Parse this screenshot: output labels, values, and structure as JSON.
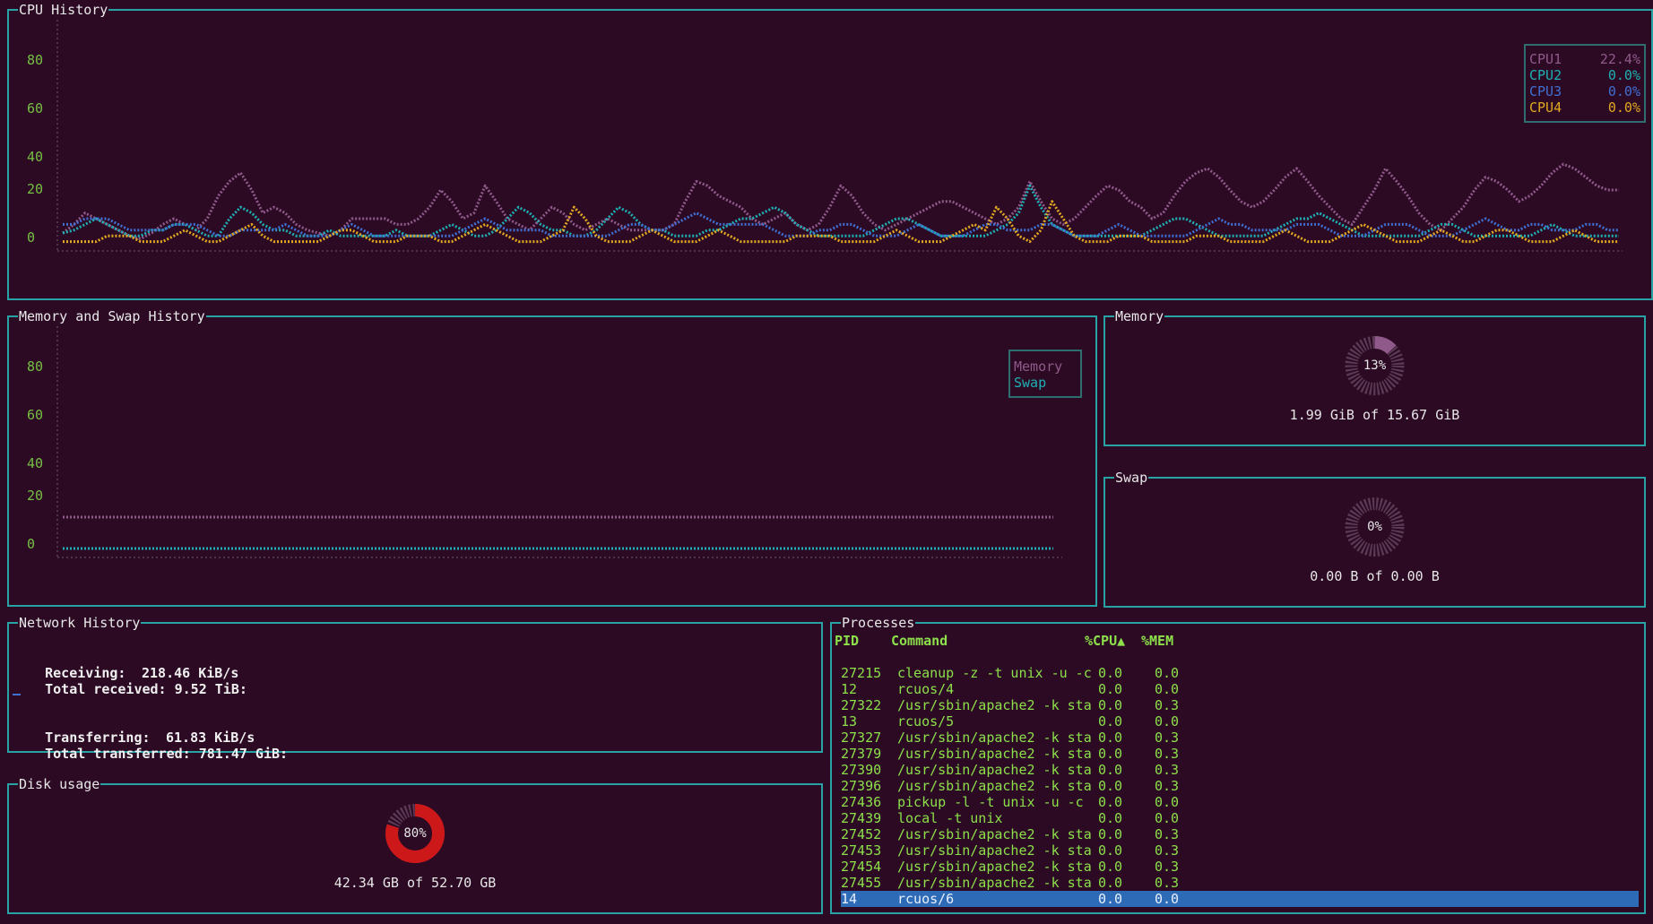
{
  "colors": {
    "border": "#27a3a6",
    "cpu1": "#8f5a8a",
    "cpu2": "#1eb0b4",
    "cpu3": "#3f6fd1",
    "cpu4": "#e2a820",
    "memory": "#8f5a8a",
    "swap": "#1eb0b4",
    "tick": "#76c043",
    "disk": "#cc1818",
    "gauge_track": "#5a3a55",
    "selected_row": "#2e6bb6",
    "proc_text": "#8ce04a"
  },
  "cpu_history": {
    "title": "CPU History",
    "y_ticks": [
      "80",
      "60",
      "40",
      "20",
      "0"
    ],
    "legend": [
      {
        "label": "CPU1",
        "value": "22.4%"
      },
      {
        "label": "CPU2",
        "value": "0.0%"
      },
      {
        "label": "CPU3",
        "value": "0.0%"
      },
      {
        "label": "CPU4",
        "value": "0.0%"
      }
    ],
    "series": {
      "cpu1": [
        5,
        8,
        12,
        10,
        8,
        6,
        4,
        3,
        5,
        8,
        10,
        8,
        6,
        10,
        18,
        24,
        28,
        20,
        12,
        14,
        12,
        8,
        6,
        5,
        4,
        6,
        10,
        10,
        10,
        10,
        8,
        8,
        10,
        14,
        20,
        16,
        10,
        12,
        22,
        16,
        10,
        8,
        6,
        10,
        14,
        12,
        8,
        6,
        8,
        10,
        8,
        6,
        6,
        6,
        6,
        8,
        16,
        24,
        22,
        18,
        16,
        14,
        10,
        8,
        10,
        12,
        8,
        6,
        8,
        14,
        22,
        18,
        12,
        8,
        6,
        8,
        10,
        12,
        14,
        16,
        16,
        14,
        12,
        10,
        8,
        10,
        14,
        24,
        16,
        10,
        8,
        10,
        14,
        18,
        22,
        20,
        16,
        14,
        10,
        12,
        18,
        24,
        28,
        30,
        26,
        20,
        16,
        14,
        16,
        20,
        26,
        30,
        24,
        18,
        14,
        10,
        8,
        14,
        20,
        30,
        24,
        18,
        12,
        8,
        6,
        10,
        14,
        20,
        26,
        24,
        20,
        16,
        18,
        22,
        28,
        32,
        30,
        26,
        22,
        20,
        20
      ],
      "cpu2": [
        5,
        6,
        8,
        10,
        8,
        6,
        4,
        4,
        6,
        6,
        8,
        8,
        6,
        4,
        4,
        10,
        14,
        12,
        8,
        6,
        6,
        4,
        4,
        4,
        6,
        4,
        4,
        4,
        4,
        4,
        6,
        4,
        4,
        4,
        6,
        8,
        6,
        4,
        4,
        6,
        10,
        14,
        12,
        8,
        6,
        6,
        4,
        4,
        6,
        10,
        14,
        12,
        8,
        6,
        6,
        4,
        4,
        4,
        6,
        6,
        8,
        10,
        10,
        12,
        14,
        12,
        8,
        6,
        4,
        4,
        4,
        4,
        4,
        6,
        8,
        10,
        10,
        8,
        6,
        4,
        4,
        4,
        4,
        4,
        6,
        8,
        12,
        22,
        14,
        8,
        6,
        4,
        4,
        4,
        4,
        4,
        4,
        4,
        6,
        8,
        10,
        10,
        8,
        6,
        4,
        4,
        4,
        4,
        4,
        6,
        8,
        10,
        10,
        12,
        10,
        8,
        6,
        4,
        4,
        4,
        4,
        4,
        4,
        6,
        8,
        8,
        6,
        4,
        4,
        4,
        4,
        4,
        4,
        6,
        8,
        6,
        4,
        4,
        4,
        4,
        4
      ],
      "cpu3": [
        8,
        8,
        10,
        10,
        10,
        8,
        6,
        6,
        6,
        6,
        8,
        8,
        8,
        6,
        4,
        4,
        6,
        6,
        6,
        6,
        8,
        6,
        4,
        4,
        4,
        6,
        8,
        6,
        4,
        4,
        4,
        4,
        4,
        4,
        4,
        4,
        6,
        8,
        10,
        8,
        6,
        6,
        6,
        6,
        4,
        4,
        4,
        4,
        4,
        4,
        6,
        8,
        8,
        6,
        6,
        8,
        10,
        12,
        10,
        8,
        8,
        8,
        8,
        8,
        6,
        4,
        4,
        4,
        6,
        6,
        8,
        8,
        6,
        4,
        4,
        4,
        6,
        8,
        6,
        4,
        4,
        4,
        6,
        8,
        8,
        6,
        6,
        6,
        8,
        8,
        6,
        4,
        4,
        4,
        6,
        8,
        6,
        4,
        4,
        4,
        4,
        4,
        6,
        8,
        10,
        8,
        8,
        6,
        6,
        6,
        6,
        8,
        8,
        8,
        6,
        4,
        4,
        4,
        6,
        8,
        8,
        8,
        6,
        4,
        4,
        4,
        6,
        8,
        10,
        8,
        6,
        6,
        8,
        8,
        6,
        6,
        6,
        8,
        8,
        6,
        6
      ],
      "cpu4": [
        2,
        2,
        2,
        2,
        4,
        4,
        4,
        2,
        2,
        2,
        4,
        6,
        4,
        2,
        2,
        4,
        6,
        8,
        4,
        2,
        2,
        2,
        2,
        2,
        4,
        6,
        6,
        4,
        2,
        2,
        2,
        4,
        4,
        4,
        2,
        2,
        4,
        6,
        8,
        6,
        4,
        2,
        2,
        2,
        4,
        6,
        14,
        10,
        4,
        2,
        2,
        2,
        4,
        6,
        4,
        2,
        2,
        2,
        4,
        6,
        4,
        2,
        2,
        2,
        2,
        2,
        4,
        4,
        4,
        4,
        2,
        2,
        2,
        2,
        4,
        6,
        4,
        2,
        2,
        2,
        4,
        6,
        8,
        6,
        14,
        10,
        4,
        2,
        6,
        16,
        10,
        4,
        2,
        2,
        2,
        4,
        4,
        4,
        2,
        2,
        2,
        2,
        4,
        4,
        4,
        2,
        2,
        2,
        2,
        4,
        6,
        4,
        2,
        2,
        2,
        4,
        6,
        8,
        6,
        4,
        2,
        2,
        2,
        4,
        6,
        4,
        2,
        2,
        4,
        6,
        6,
        4,
        2,
        2,
        2,
        4,
        6,
        4,
        2,
        2,
        2
      ]
    }
  },
  "memory_history": {
    "title": "Memory and Swap History",
    "y_ticks": [
      "80",
      "60",
      "40",
      "20",
      "0"
    ],
    "legend": [
      "Memory",
      "Swap"
    ],
    "memory_value": 13,
    "swap_value": 0
  },
  "memory": {
    "title": "Memory",
    "percent": 13,
    "percent_label": "13%",
    "text": "1.99 GiB of 15.67 GiB"
  },
  "swap": {
    "title": "Swap",
    "percent": 0,
    "percent_label": "0%",
    "text": "0.00 B of 0.00 B"
  },
  "network": {
    "title": "Network History",
    "receiving_label": "Receiving:",
    "receiving_value": "218.46 KiB/s",
    "total_received_label": "Total received:",
    "total_received_value": "9.52 TiB:",
    "transferring_label": "Transferring:",
    "transferring_value": "61.83 KiB/s",
    "total_transferred_label": "Total transferred:",
    "total_transferred_value": "781.47 GiB:"
  },
  "disk": {
    "title": "Disk usage",
    "percent": 80,
    "percent_label": "80%",
    "text": "42.34 GB of 52.70 GB"
  },
  "processes": {
    "title": "Processes",
    "headers": {
      "pid": "PID",
      "command": "Command",
      "cpu": "%CPU▲",
      "mem": "%MEM"
    },
    "rows": [
      {
        "pid": "27215",
        "command": "cleanup -z -t unix -u -c",
        "cpu": "0.0",
        "mem": "0.0"
      },
      {
        "pid": "12",
        "command": "rcuos/4",
        "cpu": "0.0",
        "mem": "0.0"
      },
      {
        "pid": "27322",
        "command": "/usr/sbin/apache2 -k sta",
        "cpu": "0.0",
        "mem": "0.3"
      },
      {
        "pid": "13",
        "command": "rcuos/5",
        "cpu": "0.0",
        "mem": "0.0"
      },
      {
        "pid": "27327",
        "command": "/usr/sbin/apache2 -k sta",
        "cpu": "0.0",
        "mem": "0.3"
      },
      {
        "pid": "27379",
        "command": "/usr/sbin/apache2 -k sta",
        "cpu": "0.0",
        "mem": "0.3"
      },
      {
        "pid": "27390",
        "command": "/usr/sbin/apache2 -k sta",
        "cpu": "0.0",
        "mem": "0.3"
      },
      {
        "pid": "27396",
        "command": "/usr/sbin/apache2 -k sta",
        "cpu": "0.0",
        "mem": "0.3"
      },
      {
        "pid": "27436",
        "command": "pickup -l -t unix -u -c",
        "cpu": "0.0",
        "mem": "0.0"
      },
      {
        "pid": "27439",
        "command": "local -t unix",
        "cpu": "0.0",
        "mem": "0.0"
      },
      {
        "pid": "27452",
        "command": "/usr/sbin/apache2 -k sta",
        "cpu": "0.0",
        "mem": "0.3"
      },
      {
        "pid": "27453",
        "command": "/usr/sbin/apache2 -k sta",
        "cpu": "0.0",
        "mem": "0.3"
      },
      {
        "pid": "27454",
        "command": "/usr/sbin/apache2 -k sta",
        "cpu": "0.0",
        "mem": "0.3"
      },
      {
        "pid": "27455",
        "command": "/usr/sbin/apache2 -k sta",
        "cpu": "0.0",
        "mem": "0.3"
      },
      {
        "pid": "14",
        "command": "rcuos/6",
        "cpu": "0.0",
        "mem": "0.0",
        "selected": true
      }
    ]
  }
}
